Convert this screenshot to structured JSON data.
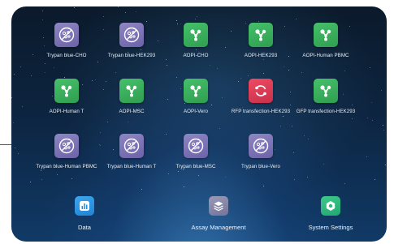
{
  "apps": [
    {
      "label": "Trypan blue-CHO",
      "color": "purple",
      "icon": "no-cell-icon"
    },
    {
      "label": "Trypan blue-HEK293",
      "color": "purple",
      "icon": "no-cell-icon"
    },
    {
      "label": "AOPI-CHO",
      "color": "green",
      "icon": "molecule-icon"
    },
    {
      "label": "AOPI-HEK293",
      "color": "green",
      "icon": "molecule-icon"
    },
    {
      "label": "AOPI-Human PBMC",
      "color": "green",
      "icon": "molecule-icon"
    },
    {
      "label": "AOPI-Human T",
      "color": "green",
      "icon": "molecule-icon"
    },
    {
      "label": "AOPI-MSC",
      "color": "green",
      "icon": "molecule-icon"
    },
    {
      "label": "AOPI-Vero",
      "color": "green",
      "icon": "molecule-icon"
    },
    {
      "label": "RFP transfection-HEK293",
      "color": "red",
      "icon": "refresh-icon"
    },
    {
      "label": "GFP transfection-HEK293",
      "color": "green",
      "icon": "molecule-icon"
    },
    {
      "label": "Trypan blue-Human PBMC",
      "color": "purple",
      "icon": "no-cell-icon"
    },
    {
      "label": "Trypan blue-Human T",
      "color": "purple",
      "icon": "no-cell-icon"
    },
    {
      "label": "Trypan blue-MSC",
      "color": "purple",
      "icon": "no-cell-icon"
    },
    {
      "label": "Trypan blue-Vero",
      "color": "purple",
      "icon": "no-cell-icon"
    }
  ],
  "dock": [
    {
      "label": "Data",
      "color": "blue",
      "icon": "chart-icon"
    },
    {
      "label": "Assay Management",
      "color": "grey",
      "icon": "layers-icon"
    },
    {
      "label": "System Settings",
      "color": "teal",
      "icon": "gear-icon"
    }
  ]
}
